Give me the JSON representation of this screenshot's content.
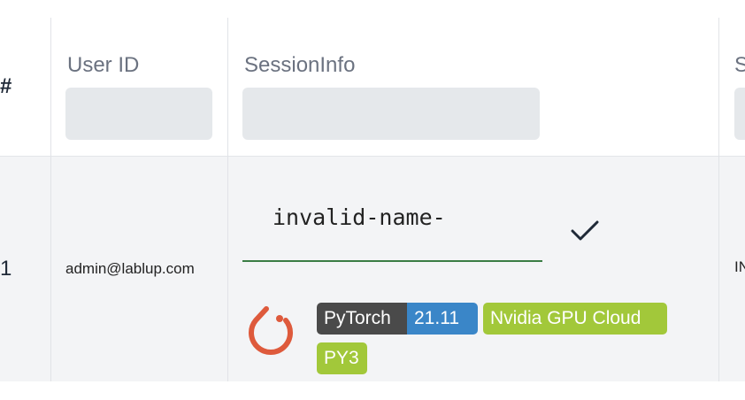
{
  "header": {
    "number_label": "#",
    "user_id_label": "User ID",
    "session_info_label": "SessionInfo",
    "next_column_label_partial": "S"
  },
  "row": {
    "number": "1",
    "user_id": "admin@lablup.com",
    "session_name_input_value": "invalid-name-",
    "status_partial": "IN",
    "framework_icon": "pytorch-logo",
    "tags": {
      "framework": "PyTorch",
      "version": "21.11",
      "vendor": "Nvidia GPU Cloud",
      "language": "PY3"
    }
  },
  "colors": {
    "input_underline": "#3a7d44",
    "tag_dark": "#4a4a4a",
    "tag_blue": "#3a86c8",
    "tag_green": "#a2c83a",
    "pytorch_orange": "#de5a3c"
  }
}
